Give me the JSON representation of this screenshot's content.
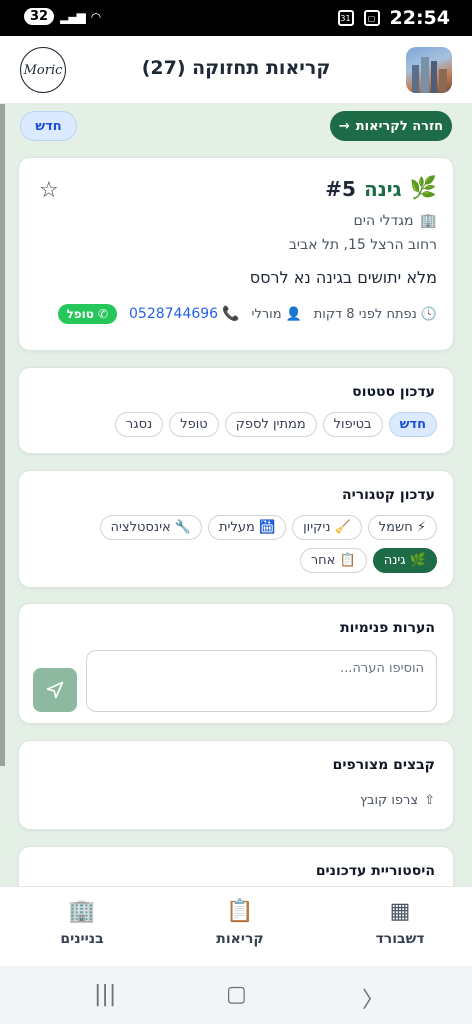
{
  "status_bar": {
    "battery": "32",
    "time": "22:54",
    "calendar": "31"
  },
  "header": {
    "title": "קריאות תחזוקה (27)",
    "logo_text": "Moric"
  },
  "actions": {
    "back_label": "חזרה לקריאות",
    "new_label": "חדש"
  },
  "ticket": {
    "category": "גינה",
    "number": "#5",
    "building": "מגדלי הים",
    "address": "רחוב הרצל 15, תל אביב",
    "description": "מלא יתושים בגינה נא לרסס",
    "opened": "נפתח לפני 8 דקות",
    "reporter": "מורלי",
    "phone": "0528744696",
    "assignee_badge": "טופל"
  },
  "status_section": {
    "title": "עדכון סטטוס",
    "options": [
      "חדש",
      "בטיפול",
      "ממתין לספק",
      "טופל",
      "נסגר"
    ],
    "selected": "חדש"
  },
  "category_section": {
    "title": "עדכון קטגוריה",
    "options": [
      {
        "icon": "⚡",
        "label": "חשמל"
      },
      {
        "icon": "🧹",
        "label": "ניקיון"
      },
      {
        "icon": "🛗",
        "label": "מעלית"
      },
      {
        "icon": "🔧",
        "label": "אינסטלציה"
      },
      {
        "icon": "🌿",
        "label": "גינה"
      },
      {
        "icon": "📋",
        "label": "אחר"
      }
    ],
    "selected": "גינה"
  },
  "notes_section": {
    "title": "הערות פנימיות",
    "placeholder": "הוסיפו הערה..."
  },
  "files_section": {
    "title": "קבצים מצורפים",
    "upload_label": "צרפו קובץ"
  },
  "history_section": {
    "title": "היסטוריית עדכונים"
  },
  "bottom_nav": {
    "dashboard": "דשבורד",
    "tickets": "קריאות",
    "buildings": "בניינים"
  },
  "colors": {
    "primary": "#1e6b47",
    "accent_blue": "#1d4ed8",
    "whatsapp": "#25c65a",
    "background": "#e4efe6"
  }
}
